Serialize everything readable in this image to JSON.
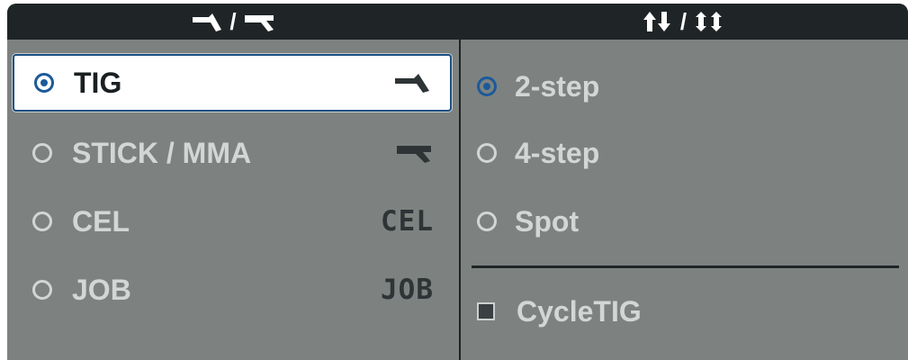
{
  "header": {
    "left": {
      "slash": "/",
      "icons": [
        "tig-torch-icon",
        "stick-electrode-icon"
      ]
    },
    "right": {
      "slash": "/",
      "icons": [
        "two-step-trigger-icon",
        "four-step-trigger-icon"
      ]
    }
  },
  "process_modes": [
    {
      "label": "TIG",
      "selected": true,
      "icon": "tig-torch-icon"
    },
    {
      "label": "STICK / MMA",
      "selected": false,
      "icon": "stick-electrode-icon"
    },
    {
      "label": "CEL",
      "selected": false,
      "icon_text": "CEL"
    },
    {
      "label": "JOB",
      "selected": false,
      "icon_text": "JOB"
    }
  ],
  "trigger_modes": [
    {
      "label": "2-step",
      "selected": true
    },
    {
      "label": "4-step",
      "selected": false
    },
    {
      "label": "Spot",
      "selected": false
    }
  ],
  "options": [
    {
      "label": "CycleTIG",
      "checked": false
    }
  ],
  "colors": {
    "panel_bg": "#7d8280",
    "header_bg": "#1f2526",
    "selection_blue": "#1b5a9a",
    "inactive_text": "#d3d6d4"
  }
}
